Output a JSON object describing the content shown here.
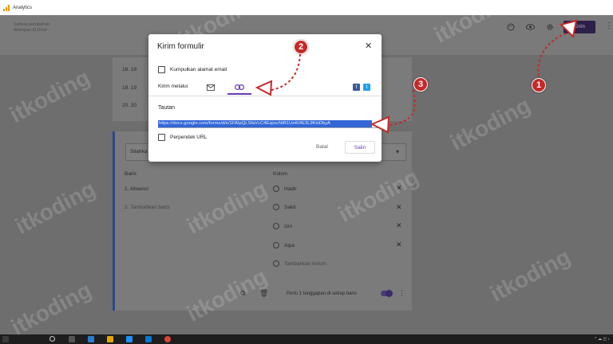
{
  "browser": {
    "bookmark_label": "Analytics"
  },
  "forms_header": {
    "save_status": "Semua perubahan disimpan di Drive",
    "send_label": "Kirim",
    "icons": [
      "palette-icon",
      "eye-icon",
      "gear-icon",
      "more-vert-icon"
    ]
  },
  "grid_rows_top": [
    "18.  18",
    "19.  19",
    "20.  20"
  ],
  "question": {
    "title_partial": "Silahka",
    "rows_heading": "Baris",
    "cols_heading": "Kolom",
    "rows": [
      "1.  Absensi",
      "2.  Tambahkan baris"
    ],
    "columns": [
      "Hadir",
      "Sakit",
      "Izin",
      "Alpa"
    ],
    "add_column": "Tambahkan kolom",
    "require_label": "Perlu 1 tanggapan di setiap baris"
  },
  "modal": {
    "title": "Kirim formulir",
    "collect_email_label": "Kumpulkan alamat email",
    "send_via_label": "Kirim melalui",
    "tabs": [
      "email-icon",
      "link-icon",
      "embed-icon"
    ],
    "active_tab": "link-icon",
    "link_heading": "Tautan",
    "link_url": "https://docs.google.com/forms/d/e/1FAIpQLSfaVcC4ExpscNtB1UeKI4E3L9KlsDbyA",
    "shorten_label": "Perpendek URL",
    "cancel_label": "Batal",
    "copy_label": "Salin"
  },
  "annotations": {
    "steps": [
      "1",
      "2",
      "3"
    ],
    "color": "#c62828"
  },
  "watermark": "itkoding",
  "accent_color": "#673ab7"
}
